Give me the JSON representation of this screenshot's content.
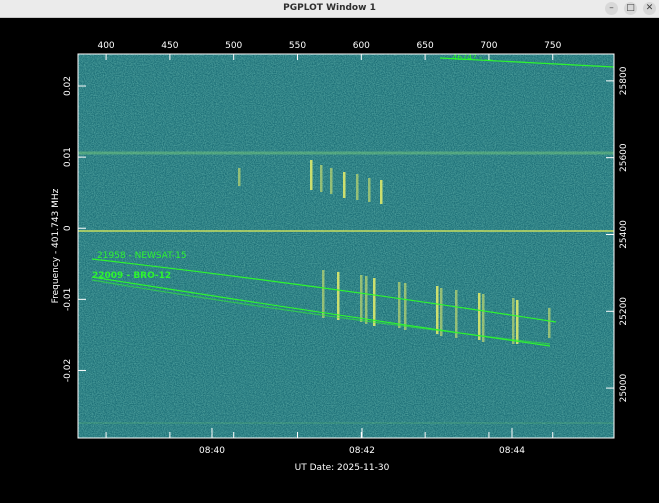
{
  "window": {
    "title": "PGPLOT Window 1",
    "controls": [
      "–",
      "□",
      "✕"
    ]
  },
  "chart_data": {
    "type": "heatmap",
    "xlabel": "UT Date: 2025-11-30",
    "ylabel": "Frequency - 401.743 MHz",
    "x_bottom_ticks": [
      "08:40",
      "08:42",
      "08:44"
    ],
    "x_top_ticks": [
      "400",
      "450",
      "500",
      "550",
      "600",
      "650",
      "700",
      "750"
    ],
    "y_left_ticks": [
      "0.02",
      "0.01",
      "0",
      "-0.01",
      "-0.02"
    ],
    "y_right_ticks": [
      "25800",
      "25600",
      "25400",
      "25200",
      "25000"
    ],
    "top_range": [
      378,
      798
    ],
    "left_range": [
      -0.0295,
      0.0245
    ],
    "right_range": [
      24870,
      25870
    ],
    "annotations": [
      "21958 - NEWSAT-15",
      "22009 - BRO-12",
      "4624? - ..."
    ],
    "colors": {
      "background": "#1a6b72",
      "track": "#33ff33",
      "frame": "#ffffff",
      "text": "#ffffff"
    }
  }
}
